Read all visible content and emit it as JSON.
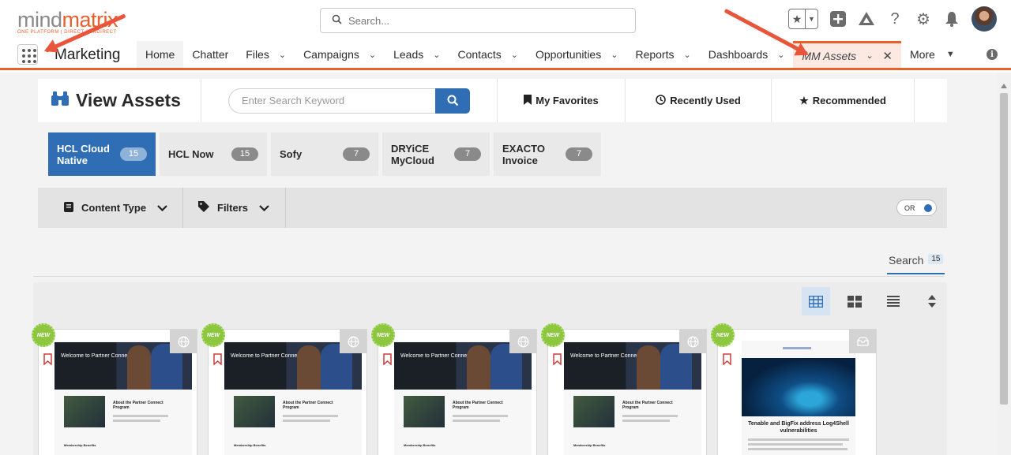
{
  "header": {
    "logo_main": "mind",
    "logo_accent": "matrix",
    "logo_tagline": "ONE PLATFORM | DIRECT & INDIRECT",
    "search_placeholder": "Search...",
    "icons": [
      "favorites-star-icon",
      "add-icon",
      "trailhead-icon",
      "help-icon",
      "settings-gear-icon",
      "notifications-bell-icon",
      "user-avatar"
    ]
  },
  "nav": {
    "app_name": "Marketing",
    "items": [
      {
        "label": "Home",
        "has_menu": false
      },
      {
        "label": "Chatter",
        "has_menu": false
      },
      {
        "label": "Files",
        "has_menu": true
      },
      {
        "label": "Campaigns",
        "has_menu": true
      },
      {
        "label": "Leads",
        "has_menu": true
      },
      {
        "label": "Contacts",
        "has_menu": true
      },
      {
        "label": "Opportunities",
        "has_menu": true
      },
      {
        "label": "Reports",
        "has_menu": true
      },
      {
        "label": "Dashboards",
        "has_menu": true
      }
    ],
    "active_tab": "MM Assets",
    "more_label": "More"
  },
  "assets": {
    "title": "View Assets",
    "keyword_placeholder": "Enter Search Keyword",
    "tabs": [
      "My Favorites",
      "Recently Used",
      "Recommended"
    ],
    "chips": [
      {
        "line1": "HCL Cloud",
        "line2": "Native",
        "count": "15",
        "selected": true
      },
      {
        "line1": "HCL Now",
        "line2": "",
        "count": "15",
        "selected": false
      },
      {
        "line1": "Sofy",
        "line2": "",
        "count": "7",
        "selected": false
      },
      {
        "line1": "DRYiCE",
        "line2": "MyCloud",
        "count": "7",
        "selected": false
      },
      {
        "line1": "EXACTO",
        "line2": "Invoice",
        "count": "7",
        "selected": false
      }
    ],
    "filters": {
      "content_type": "Content Type",
      "filters": "Filters",
      "toggle_label": "OR"
    },
    "search_tab": {
      "label": "Search",
      "count": "15"
    },
    "view_modes": [
      "table-view-icon",
      "tile-view-icon",
      "list-view-icon",
      "sort-icon"
    ],
    "cards": [
      {
        "badge": "NEW",
        "type_icon": "globe-icon",
        "hero_title": "Welcome to Partner Connect",
        "sub_title": "About the Partner Connect Program",
        "section": "Membership Benefits"
      },
      {
        "badge": "NEW",
        "type_icon": "globe-icon",
        "hero_title": "Welcome to Partner Connect",
        "sub_title": "About the Partner Connect Program",
        "section": "Membership Benefits"
      },
      {
        "badge": "NEW",
        "type_icon": "globe-icon",
        "hero_title": "Welcome to Partner Connect",
        "sub_title": "About the Partner Connect Program",
        "section": "Membership Benefits"
      },
      {
        "badge": "NEW",
        "type_icon": "globe-icon",
        "hero_title": "Welcome to Partner Connect",
        "sub_title": "About the Partner Connect Program",
        "section": "Membership Benefits"
      },
      {
        "badge": "NEW",
        "type_icon": "email-icon",
        "title": "Tenable and BigFix address Log4Shell vulnerabilities"
      }
    ]
  },
  "colors": {
    "accent": "#e8602c",
    "primary": "#2f6eb5",
    "new_badge": "#8dc63f",
    "annotation": "#e8553a"
  }
}
